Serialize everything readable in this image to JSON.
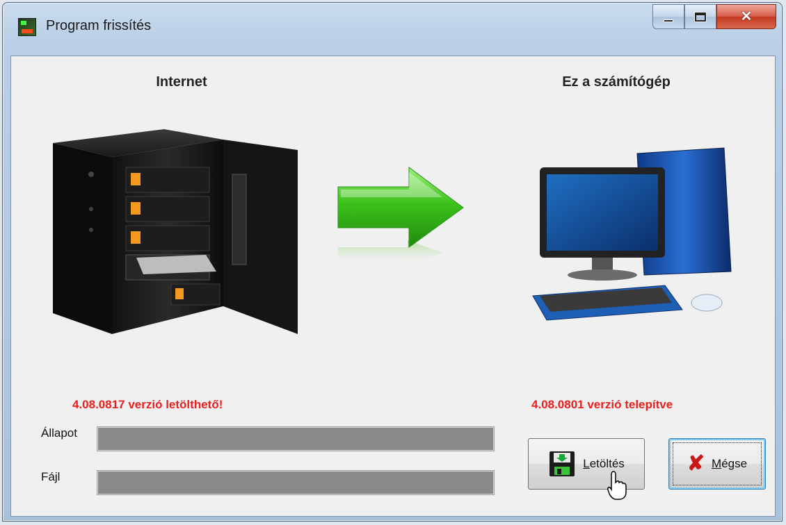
{
  "window": {
    "title": "Program frissítés"
  },
  "headings": {
    "internet": "Internet",
    "computer": "Ez a számítógép"
  },
  "versions": {
    "remote_status": "4.08.0817 verzió letölthető!",
    "local_status": "4.08.0801 verzió telepítve"
  },
  "progress": {
    "state_label": "Állapot",
    "state_value": 0,
    "file_label": "Fájl",
    "file_value": 0
  },
  "buttons": {
    "download_label_underlined": "L",
    "download_label_rest": "etöltés",
    "cancel_label_underlined": "M",
    "cancel_label_rest": "égse"
  },
  "icons": {
    "app": "app-icon",
    "server": "nas-server-icon",
    "arrow": "green-arrow-icon",
    "computer": "desktop-computer-icon",
    "download": "floppy-disk-download-icon",
    "cancel": "red-x-icon",
    "cursor": "mouse-pointer-icon"
  },
  "colors": {
    "status_red": "#e8201f",
    "progress_track": "#8a8a8a",
    "arrow_green": "#3cc21b"
  }
}
